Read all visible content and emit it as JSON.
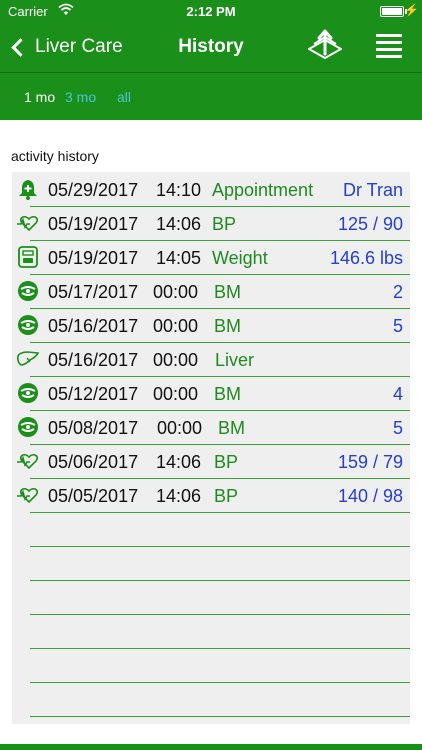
{
  "status_bar": {
    "carrier": "Carrier",
    "time": "2:12 PM",
    "wifi_icon": "wifi-icon",
    "battery_icon": "battery-icon",
    "charging_icon": "charging-bolt-icon"
  },
  "nav": {
    "back_label": "Liver Care",
    "title": "History",
    "share_icon": "share-upload-icon",
    "menu_icon": "menu-icon"
  },
  "filters": [
    {
      "label": "1 mo",
      "selected": true
    },
    {
      "label": "3 mo",
      "selected": false
    },
    {
      "label": "all",
      "selected": false
    }
  ],
  "section_title": "activity history",
  "rows": [
    {
      "icon": "appointment-bell-icon",
      "date": "05/29/2017",
      "time": "14:10",
      "type": "Appointment",
      "value": "Dr Tran"
    },
    {
      "icon": "heart-pulse-icon",
      "date": "05/19/2017",
      "time": "14:06",
      "type": "BP",
      "value": "125 / 90"
    },
    {
      "icon": "scale-icon",
      "date": "05/19/2017",
      "time": "14:05",
      "type": "Weight",
      "value": "146.6 lbs"
    },
    {
      "icon": "bm-icon",
      "date": "05/17/2017",
      "time": "00:00",
      "type": "BM",
      "value": "2"
    },
    {
      "icon": "bm-icon",
      "date": "05/16/2017",
      "time": "00:00",
      "type": "BM",
      "value": "5"
    },
    {
      "icon": "liver-icon",
      "date": "05/16/2017",
      "time": "00:00",
      "type": "Liver",
      "value": ""
    },
    {
      "icon": "bm-icon",
      "date": "05/12/2017",
      "time": "00:00",
      "type": "BM",
      "value": "4"
    },
    {
      "icon": "bm-icon",
      "date": "05/08/2017",
      "time": "00:00",
      "type": "BM",
      "value": "5"
    },
    {
      "icon": "heart-pulse-icon",
      "date": "05/06/2017",
      "time": "14:06",
      "type": "BP",
      "value": "159 / 79"
    },
    {
      "icon": "heart-pulse-icon",
      "date": "05/05/2017",
      "time": "14:06",
      "type": "BP",
      "value": "140 / 98"
    }
  ],
  "colors": {
    "brand_green": "#1a8f1a",
    "type_green": "#1f8a1f",
    "value_blue": "#2440cc",
    "filter_inactive": "#4fc3d6",
    "panel_bg": "#efefef"
  }
}
